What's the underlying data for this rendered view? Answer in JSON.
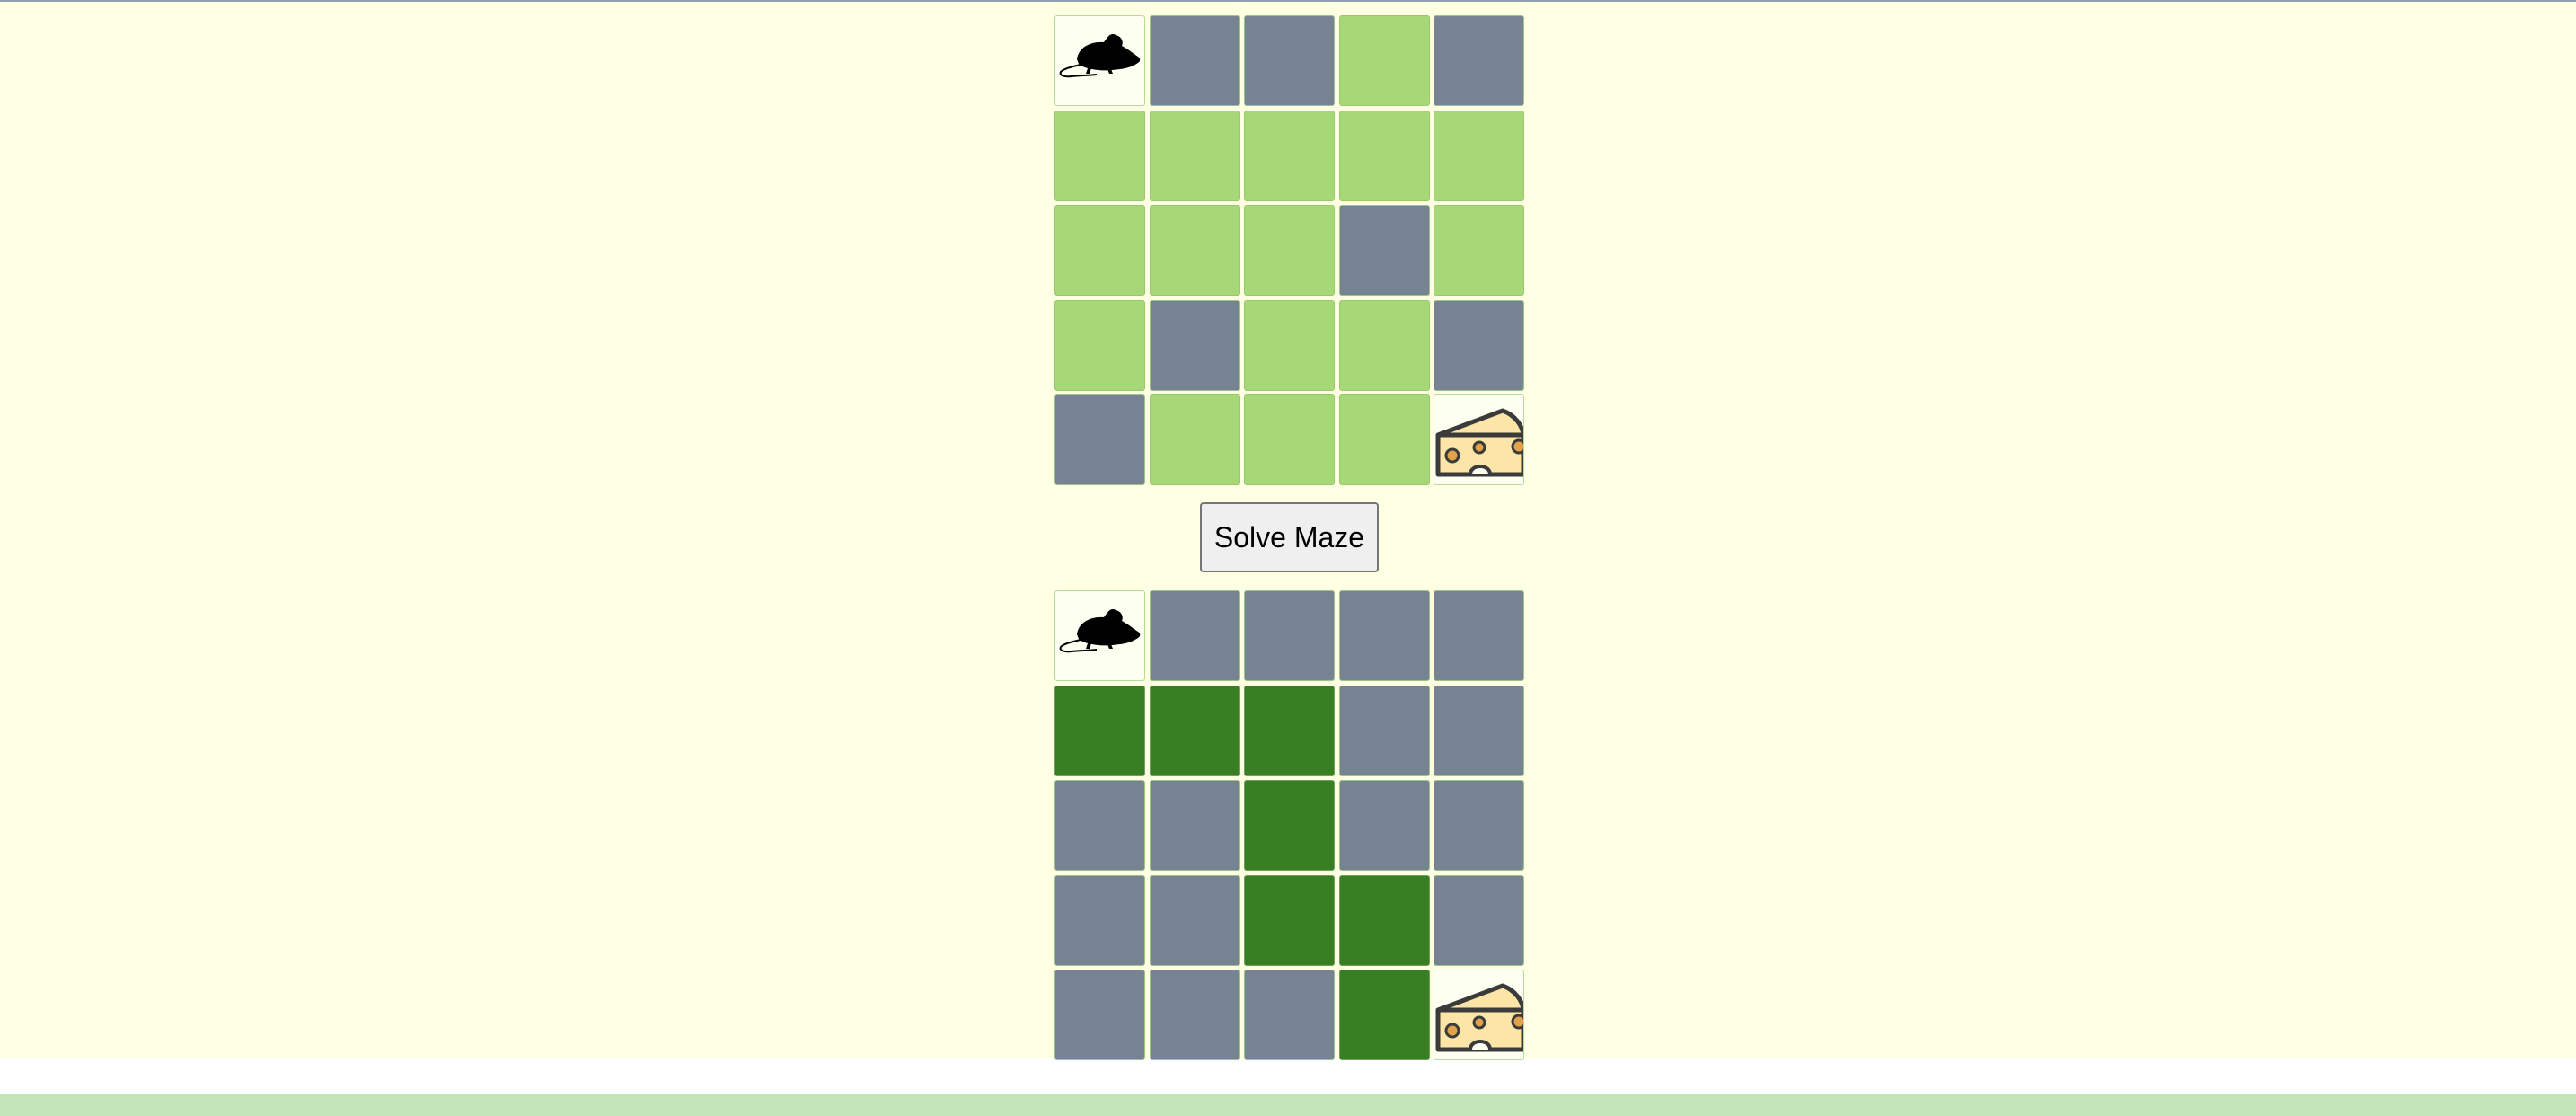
{
  "colors": {
    "page_background": "#ffffe4",
    "wall": "#778392",
    "open": "#a7d878",
    "solution_path": "#387f23",
    "endpoint_background": "#fdfff0",
    "footer_bar": "#c3e5b8"
  },
  "icons": {
    "start": "mouse-icon",
    "goal": "cheese-icon"
  },
  "maze": {
    "rows": 5,
    "cols": 5,
    "cells": [
      [
        "start",
        "wall",
        "wall",
        "open",
        "wall"
      ],
      [
        "open",
        "open",
        "open",
        "open",
        "open"
      ],
      [
        "open",
        "open",
        "open",
        "wall",
        "open"
      ],
      [
        "open",
        "wall",
        "open",
        "open",
        "wall"
      ],
      [
        "wall",
        "open",
        "open",
        "open",
        "goal"
      ]
    ]
  },
  "controls": {
    "solve_label": "Solve Maze"
  },
  "solution": {
    "rows": 5,
    "cols": 5,
    "cells": [
      [
        "start",
        "wall",
        "wall",
        "wall",
        "wall"
      ],
      [
        "path",
        "path",
        "path",
        "wall",
        "wall"
      ],
      [
        "wall",
        "wall",
        "path",
        "wall",
        "wall"
      ],
      [
        "wall",
        "wall",
        "path",
        "path",
        "wall"
      ],
      [
        "wall",
        "wall",
        "wall",
        "path",
        "goal"
      ]
    ]
  }
}
